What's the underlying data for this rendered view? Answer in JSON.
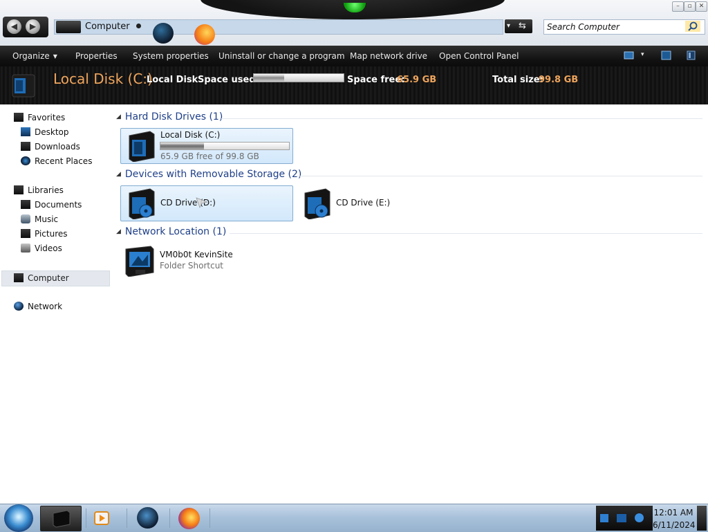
{
  "window": {
    "controls": {
      "minimize": "–",
      "maximize": "▫",
      "close": "✕"
    }
  },
  "address_bar": {
    "location": "Computer",
    "nav_back": "◀",
    "nav_forward": "▶",
    "dropdown": "▾",
    "refresh": "⇆"
  },
  "search": {
    "placeholder": "Search Computer"
  },
  "command_bar": {
    "items": [
      {
        "label": "Organize",
        "has_menu": true
      },
      {
        "label": "Properties"
      },
      {
        "label": "System properties"
      },
      {
        "label": "Uninstall or change a program"
      },
      {
        "label": "Map network drive"
      },
      {
        "label": "Open Control Panel"
      }
    ],
    "view_menu_caret": "▾"
  },
  "details": {
    "title": "Local Disk (C:)",
    "type_label": "Local Disk",
    "space_used_label": "Space used:",
    "space_used_fraction": 0.34,
    "space_free_label": "Space free:",
    "space_free_value": "65.9 GB",
    "total_size_label": "Total size:",
    "total_size_value": "99.8 GB"
  },
  "nav_pane": {
    "favorites": {
      "label": "Favorites",
      "items": [
        "Desktop",
        "Downloads",
        "Recent Places"
      ]
    },
    "libraries": {
      "label": "Libraries",
      "items": [
        "Documents",
        "Music",
        "Pictures",
        "Videos"
      ]
    },
    "computer": {
      "label": "Computer"
    },
    "network": {
      "label": "Network"
    }
  },
  "groups": {
    "hard_disks": {
      "header": "Hard Disk Drives (1)",
      "items": [
        {
          "name": "Local Disk (C:)",
          "free_text": "65.9 GB free of 99.8 GB",
          "used_fraction": 0.34
        }
      ]
    },
    "removable": {
      "header": "Devices with Removable Storage (2)",
      "items": [
        {
          "name": "CD Drive (D:)"
        },
        {
          "name": "CD Drive (E:)"
        }
      ]
    },
    "network": {
      "header": "Network Location (1)",
      "items": [
        {
          "name": "VM0b0t KevinSite",
          "type": "Folder Shortcut"
        }
      ]
    }
  },
  "taskbar": {
    "clock_time": "12:01 AM",
    "clock_date": "6/11/2024"
  },
  "colors": {
    "accent_orange": "#f0a55c",
    "group_header_blue": "#1e3f88",
    "selection_border": "#84acd1"
  },
  "icons": {
    "drive": "hard-drive-icon",
    "cd": "cd-drive-icon",
    "network_location": "network-folder-icon"
  }
}
